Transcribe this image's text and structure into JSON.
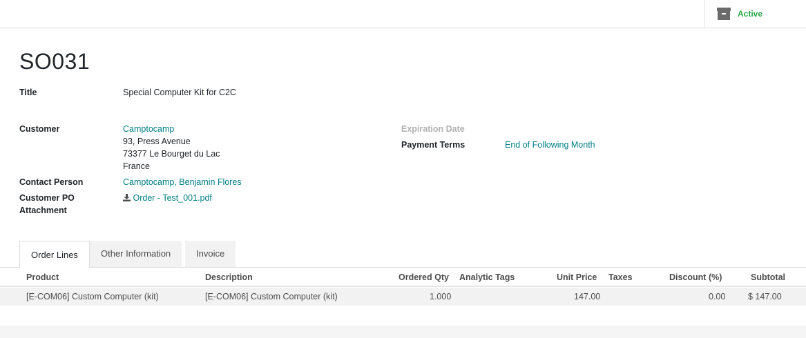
{
  "status": {
    "label": "Active",
    "icon": "archive-icon",
    "color": "#28a745"
  },
  "record": {
    "name": "SO031"
  },
  "fields": {
    "title_label": "Title",
    "title_value": "Special Computer Kit for C2C",
    "customer_label": "Customer",
    "customer_name": "Camptocamp",
    "customer_address_1": "93, Press Avenue",
    "customer_address_2": "73377 Le Bourget du Lac",
    "customer_address_3": "France",
    "contact_label": "Contact Person",
    "contact_value": "Camptocamp, Benjamin Flores",
    "po_label_1": "Customer PO",
    "po_label_2": "Attachment",
    "po_value": "Order - Test_001.pdf",
    "expiration_label": "Expiration Date",
    "payment_terms_label": "Payment Terms",
    "payment_terms_value": "End of Following Month"
  },
  "tabs": [
    {
      "label": "Order Lines",
      "active": true
    },
    {
      "label": "Other Information",
      "active": false
    },
    {
      "label": "Invoice",
      "active": false
    }
  ],
  "table": {
    "headers": [
      "Product",
      "Description",
      "Ordered Qty",
      "Analytic Tags",
      "Unit Price",
      "Taxes",
      "Discount (%)",
      "Subtotal"
    ],
    "rows": [
      [
        "[E-COM06] Custom Computer (kit)",
        "[E-COM06] Custom Computer (kit)",
        "1.000",
        "",
        "147.00",
        "",
        "0.00",
        "$ 147.00"
      ]
    ]
  },
  "colors": {
    "link": "#017e84",
    "status": "#28a745"
  }
}
